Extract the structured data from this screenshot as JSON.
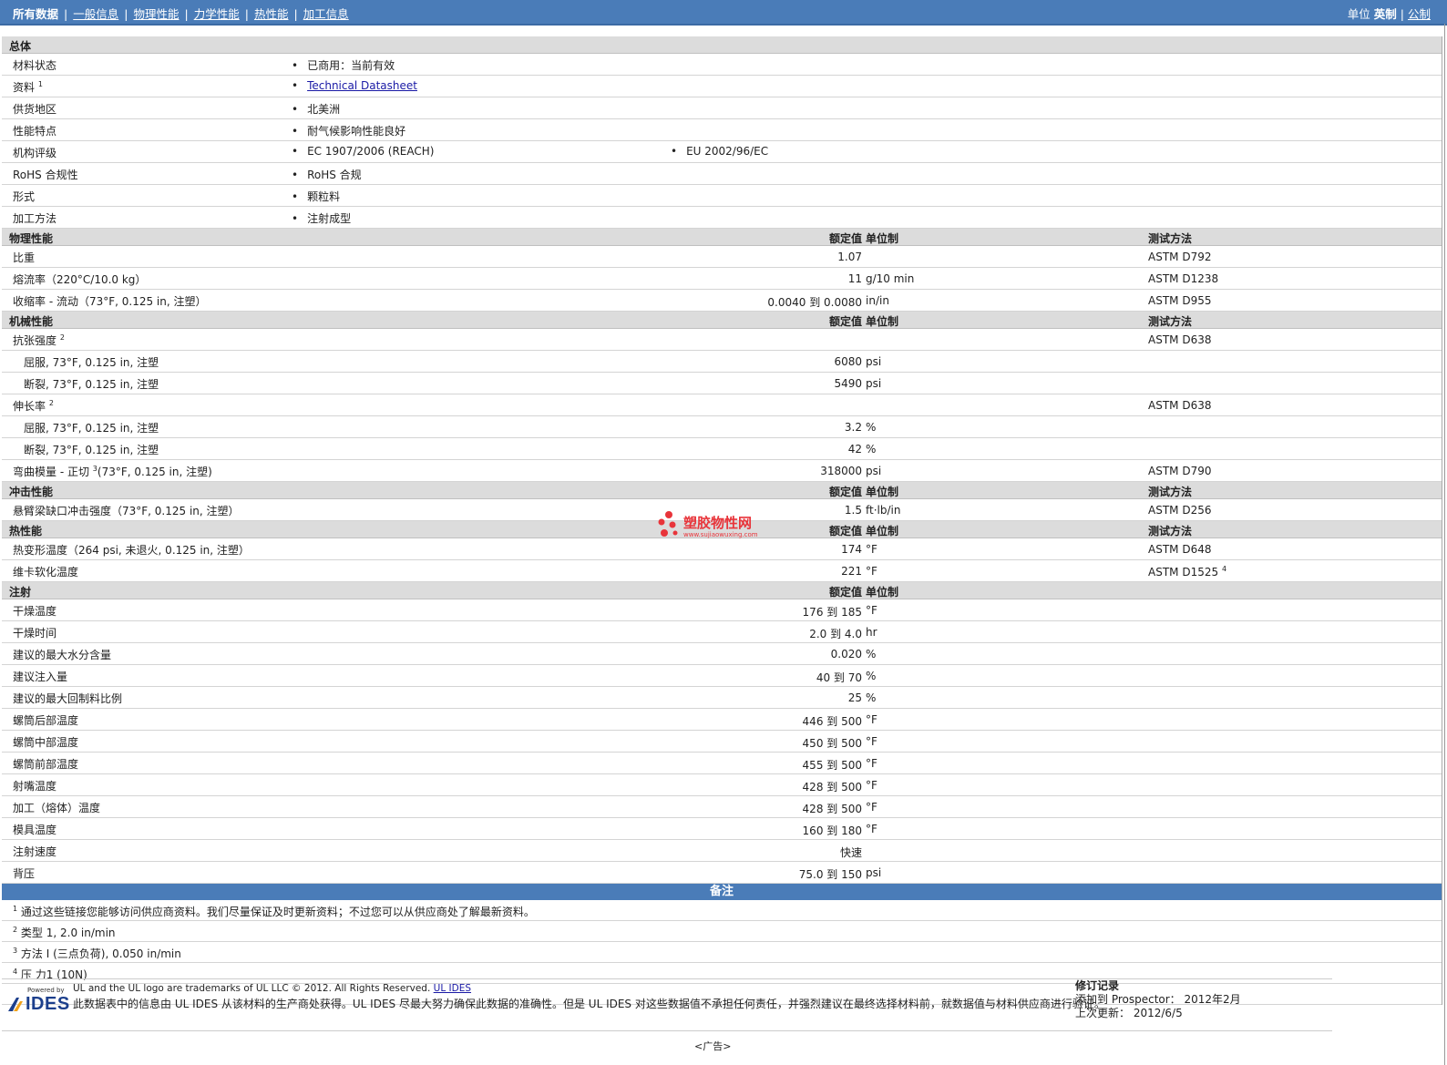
{
  "nav": {
    "tabs": [
      "所有数据",
      "一般信息",
      "物理性能",
      "力学性能",
      "热性能",
      "加工信息"
    ],
    "units_label": "单位",
    "unit_active": "英制",
    "unit_other": "公制"
  },
  "general": {
    "title": "总体",
    "rows": [
      {
        "label": "材料状态",
        "v1": "已商用：当前有效"
      },
      {
        "label": "资料",
        "sup": "1",
        "v1": "Technical Datasheet"
      },
      {
        "label": "供货地区",
        "v1": "北美洲"
      },
      {
        "label": "性能特点",
        "v1": "耐气候影响性能良好"
      },
      {
        "label": "机构评级",
        "v1": "EC 1907/2006 (REACH)",
        "v2": "EU 2002/96/EC"
      },
      {
        "label": "RoHS 合规性",
        "v1": "RoHS 合规"
      },
      {
        "label": "形式",
        "v1": "颗粒料"
      },
      {
        "label": "加工方法",
        "v1": "注射成型"
      }
    ]
  },
  "col_headers": {
    "value": "额定值",
    "unit": "单位制",
    "test": "测试方法"
  },
  "physical": {
    "title": "物理性能",
    "rows": [
      {
        "label": "比重",
        "value": "1.07",
        "unit": "",
        "test": "ASTM D792"
      },
      {
        "label": "熔流率（220°C/10.0 kg）",
        "value": "11",
        "unit": "g/10 min",
        "test": "ASTM D1238"
      },
      {
        "label": "收缩率 - 流动（73°F, 0.125 in, 注塑）",
        "value": "0.0040 到 0.0080",
        "unit": "in/in",
        "test": "ASTM D955"
      }
    ]
  },
  "mechanical": {
    "title": "机械性能",
    "rows": [
      {
        "label": "抗张强度",
        "sup": "2",
        "value": "",
        "unit": "",
        "test": "ASTM D638"
      },
      {
        "label": "屈服, 73°F, 0.125 in, 注塑",
        "sub": true,
        "value": "6080",
        "unit": "psi",
        "test": ""
      },
      {
        "label": "断裂, 73°F, 0.125 in, 注塑",
        "sub": true,
        "value": "5490",
        "unit": "psi",
        "test": ""
      },
      {
        "label": "伸长率",
        "sup": "2",
        "value": "",
        "unit": "",
        "test": "ASTM D638"
      },
      {
        "label": "屈服, 73°F, 0.125 in, 注塑",
        "sub": true,
        "value": "3.2",
        "unit": "%",
        "test": ""
      },
      {
        "label": "断裂, 73°F, 0.125 in, 注塑",
        "sub": true,
        "value": "42",
        "unit": "%",
        "test": ""
      },
      {
        "label": "弯曲模量 - 正切",
        "sup": "3",
        "suffix": "(73°F, 0.125 in, 注塑)",
        "value": "318000",
        "unit": "psi",
        "test": "ASTM D790"
      }
    ]
  },
  "impact": {
    "title": "冲击性能",
    "rows": [
      {
        "label": "悬臂梁缺口冲击强度（73°F, 0.125 in, 注塑）",
        "value": "1.5",
        "unit": "ft·lb/in",
        "test": "ASTM D256"
      }
    ]
  },
  "thermal": {
    "title": "热性能",
    "rows": [
      {
        "label": "热变形温度（264 psi, 未退火, 0.125 in, 注塑）",
        "value": "174",
        "unit": "°F",
        "test": "ASTM D648"
      },
      {
        "label": "维卡软化温度",
        "value": "221",
        "unit": "°F",
        "test": "ASTM D1525",
        "test_sup": "4"
      }
    ]
  },
  "injection": {
    "title": "注射",
    "rows": [
      {
        "label": "干燥温度",
        "value": "176 到  185",
        "unit": "°F"
      },
      {
        "label": "干燥时间",
        "value": "2.0 到  4.0",
        "unit": "hr"
      },
      {
        "label": "建议的最大水分含量",
        "value": "0.020",
        "unit": "%"
      },
      {
        "label": "建议注入量",
        "value": "40 到  70",
        "unit": "%"
      },
      {
        "label": "建议的最大回制料比例",
        "value": "25",
        "unit": "%"
      },
      {
        "label": "螺筒后部温度",
        "value": "446 到  500",
        "unit": "°F"
      },
      {
        "label": "螺筒中部温度",
        "value": "450 到  500",
        "unit": "°F"
      },
      {
        "label": "螺筒前部温度",
        "value": "455 到  500",
        "unit": "°F"
      },
      {
        "label": "射嘴温度",
        "value": "428 到  500",
        "unit": "°F"
      },
      {
        "label": "加工（熔体）温度",
        "value": "428 到  500",
        "unit": "°F"
      },
      {
        "label": "模具温度",
        "value": "160 到  180",
        "unit": "°F"
      },
      {
        "label": "注射速度",
        "value": "快速",
        "unit": ""
      },
      {
        "label": "背压",
        "value": "75.0 到  150",
        "unit": "psi"
      }
    ]
  },
  "notes": {
    "title": "备注",
    "items": [
      {
        "num": "1",
        "text": "通过这些链接您能够访问供应商资料。我们尽量保证及时更新资料；不过您可以从供应商处了解最新资料。"
      },
      {
        "num": "2",
        "text": "类型  1, 2.0 in/min"
      },
      {
        "num": "3",
        "text": "方法  I (三点负荷), 0.050 in/min"
      },
      {
        "num": "4",
        "text": "压  力1 (10N)"
      }
    ]
  },
  "footer": {
    "powered_by": "Powered by",
    "logo_text": "IDES",
    "line1": "UL and the UL logo are trademarks of UL LLC © 2012. All Rights Reserved.",
    "line1_link": "UL IDES",
    "line2": "此数据表中的信息由  UL IDES 从该材料的生产商处获得。UL IDES 尽最大努力确保此数据的准确性。但是  UL IDES 对这些数据值不承担任何责任，并强烈建议在最终选择材料前，就数据值与材料供应商进行验证。",
    "rev_title": "修订记录",
    "rev_added": "添加到  Prospector：  2012年2月",
    "rev_updated": "上次更新：  2012/6/5"
  },
  "watermark": {
    "text": "塑胶物性网",
    "sub": "www.sujiaowuxing.com"
  },
  "ad": "<广告>",
  "colors": {
    "bar": "#4a7cb8",
    "header_row": "#dcdcdc",
    "watermark": "#e8343a",
    "link": "#1a1aa6"
  }
}
